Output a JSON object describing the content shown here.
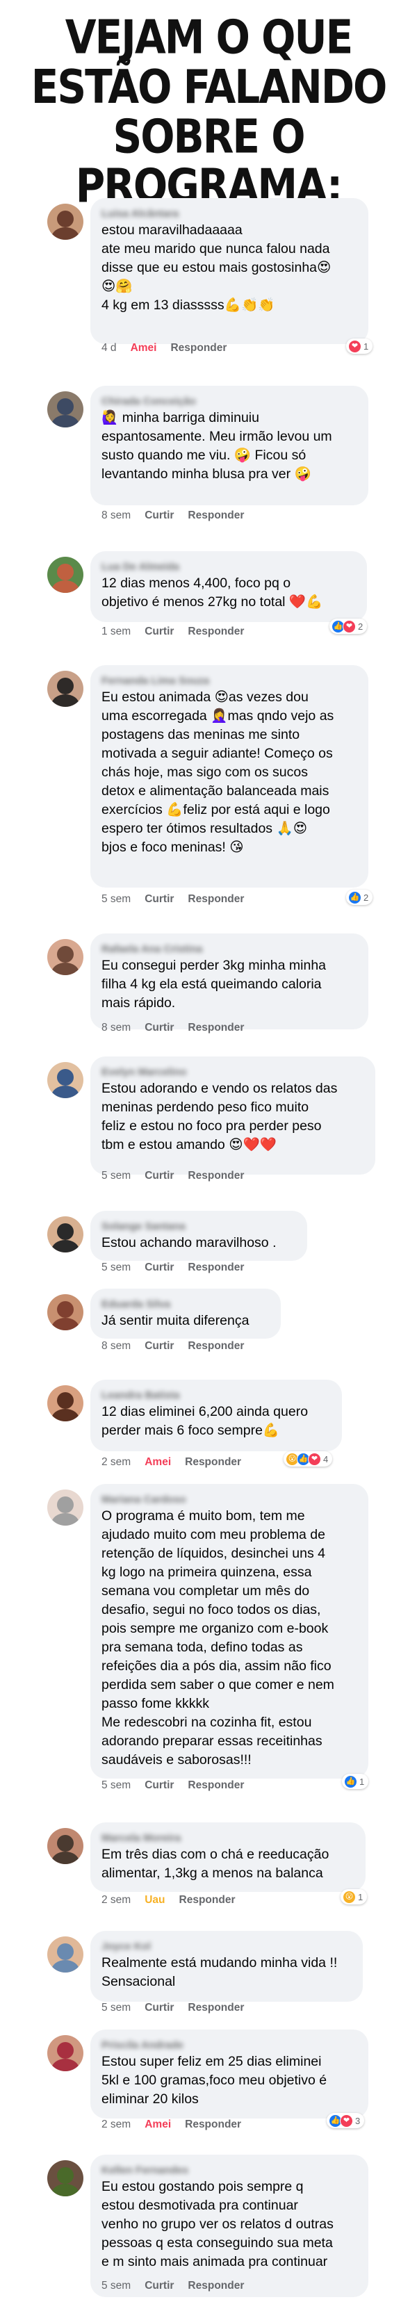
{
  "title": "VEJAM O QUE ESTÃO FALANDO SOBRE O PROGRAMA:",
  "comments": [
    {
      "name": "Luisa Alcântara",
      "text": "estou maravilhadaaaaa\nate meu marido que nunca falou nada\ndisse que eu estou mais gostosinha😍\n😍🤗\n4 kg em 13 diasssss💪👏👏",
      "time": "4 d",
      "action": "Amei",
      "reply": "Responder",
      "reactions": [
        "love"
      ],
      "count": "1"
    },
    {
      "name": "Chirada Conceição",
      "text": "🙋‍♀️ minha barriga diminuiu\nespantosamente. Meu irmão levou um\nsusto quando me viu. 🤪 Ficou só\nlevantando minha blusa pra ver 🤪",
      "time": "8 sem",
      "action": "Curtir",
      "reply": "Responder",
      "reactions": [],
      "count": ""
    },
    {
      "name": "Lua De Almeida",
      "text": "12 dias menos 4,400, foco pq o\nobjetivo é menos 27kg no total ❤️💪",
      "time": "1 sem",
      "action": "Curtir",
      "reply": "Responder",
      "reactions": [
        "like",
        "love"
      ],
      "count": "2"
    },
    {
      "name": "Fernanda Lima Souza",
      "text": "Eu estou animada 😍as vezes dou\numa escorregada 🤦‍♀️mas qndo vejo as\npostagens das meninas me sinto\nmotivada a seguir adiante! Começo os\nchás hoje, mas sigo com os sucos\ndetox e alimentação balanceada mais\nexercícios 💪feliz por está aqui e logo\nespero ter ótimos resultados 🙏😍\nbjos e foco meninas! 😘",
      "time": "5 sem",
      "action": "Curtir",
      "reply": "Responder",
      "reactions": [
        "like"
      ],
      "count": "2"
    },
    {
      "name": "Rafaela Ana Cristina",
      "text": "Eu consegui perder 3kg minha minha\nfilha 4 kg ela está queimando caloria\nmais rápido.",
      "time": "8 sem",
      "action": "Curtir",
      "reply": "Responder",
      "reactions": [],
      "count": ""
    },
    {
      "name": "Evelyn Marcelino",
      "text": "Estou adorando e vendo os relatos das\nmeninas perdendo peso fico muito\nfeliz e estou no foco pra perder peso\ntbm e estou amando 😍❤️❤️",
      "time": "5 sem",
      "action": "Curtir",
      "reply": "Responder",
      "reactions": [],
      "count": ""
    },
    {
      "name": "Solange Santana",
      "text": "Estou achando maravilhoso .",
      "time": "5 sem",
      "action": "Curtir",
      "reply": "Responder",
      "reactions": [],
      "count": ""
    },
    {
      "name": "Eduarda Silva",
      "text": "Já sentir muita diferença",
      "time": "8 sem",
      "action": "Curtir",
      "reply": "Responder",
      "reactions": [],
      "count": ""
    },
    {
      "name": "Leandra Batista",
      "text": "12 dias eliminei 6,200 ainda quero\nperder mais 6 foco sempre💪",
      "time": "2 sem",
      "action": "Amei",
      "reply": "Responder",
      "reactions": [
        "wow",
        "like",
        "love"
      ],
      "count": "4"
    },
    {
      "name": "Mariana Cardoso",
      "text": "O programa é muito bom, tem me\najudado muito com meu problema de\nretenção de líquidos, desinchei uns 4\nkg logo na primeira quinzena, essa\nsemana vou completar um mês do\ndesafio, segui no foco todos os dias,\npois sempre me organizo com e-book\npra semana toda, defino todas as\nrefeições dia a pós dia, assim não fico\nperdida sem saber o que comer e nem\npasso fome kkkkk\nMe redescobri na cozinha fit, estou\nadorando preparar essas receitinhas\nsaudáveis e saborosas!!!",
      "time": "5 sem",
      "action": "Curtir",
      "reply": "Responder",
      "reactions": [
        "like"
      ],
      "count": "1"
    },
    {
      "name": "Marcela Moreira",
      "text": "Em três dias com o chá e reeducação\nalimentar, 1,3kg a menos na balanca",
      "time": "2 sem",
      "action": "Uau",
      "reply": "Responder",
      "reactions": [
        "wow"
      ],
      "count": "1"
    },
    {
      "name": "Joyce Kol",
      "text": "Realmente está mudando minha vida !!\nSensacional",
      "time": "5 sem",
      "action": "Curtir",
      "reply": "Responder",
      "reactions": [],
      "count": ""
    },
    {
      "name": "Priscila Andrade",
      "text": "Estou super feliz em 25 dias eliminei\n5kl e 100 gramas,foco meu objetivo é\neliminar 20 kilos",
      "time": "2 sem",
      "action": "Amei",
      "reply": "Responder",
      "reactions": [
        "like",
        "love"
      ],
      "count": "3"
    },
    {
      "name": "Kellen Fernandes",
      "text": "Eu estou gostando pois sempre q\nestou desmotivada pra continuar\nvenho no grupo ver os relatos d outras\npessoas q esta conseguindo sua meta\ne m sinto mais animada pra continuar",
      "time": "5 sem",
      "action": "Curtir",
      "reply": "Responder",
      "reactions": [],
      "count": ""
    }
  ],
  "reaction_icons": {
    "like": "👍",
    "love": "❤",
    "wow": "😮"
  },
  "colors": {
    "bubble": "#f0f2f5",
    "amei": "#f33e58",
    "uau": "#f7b125",
    "like": "#1877f2",
    "meta": "#65676b"
  }
}
